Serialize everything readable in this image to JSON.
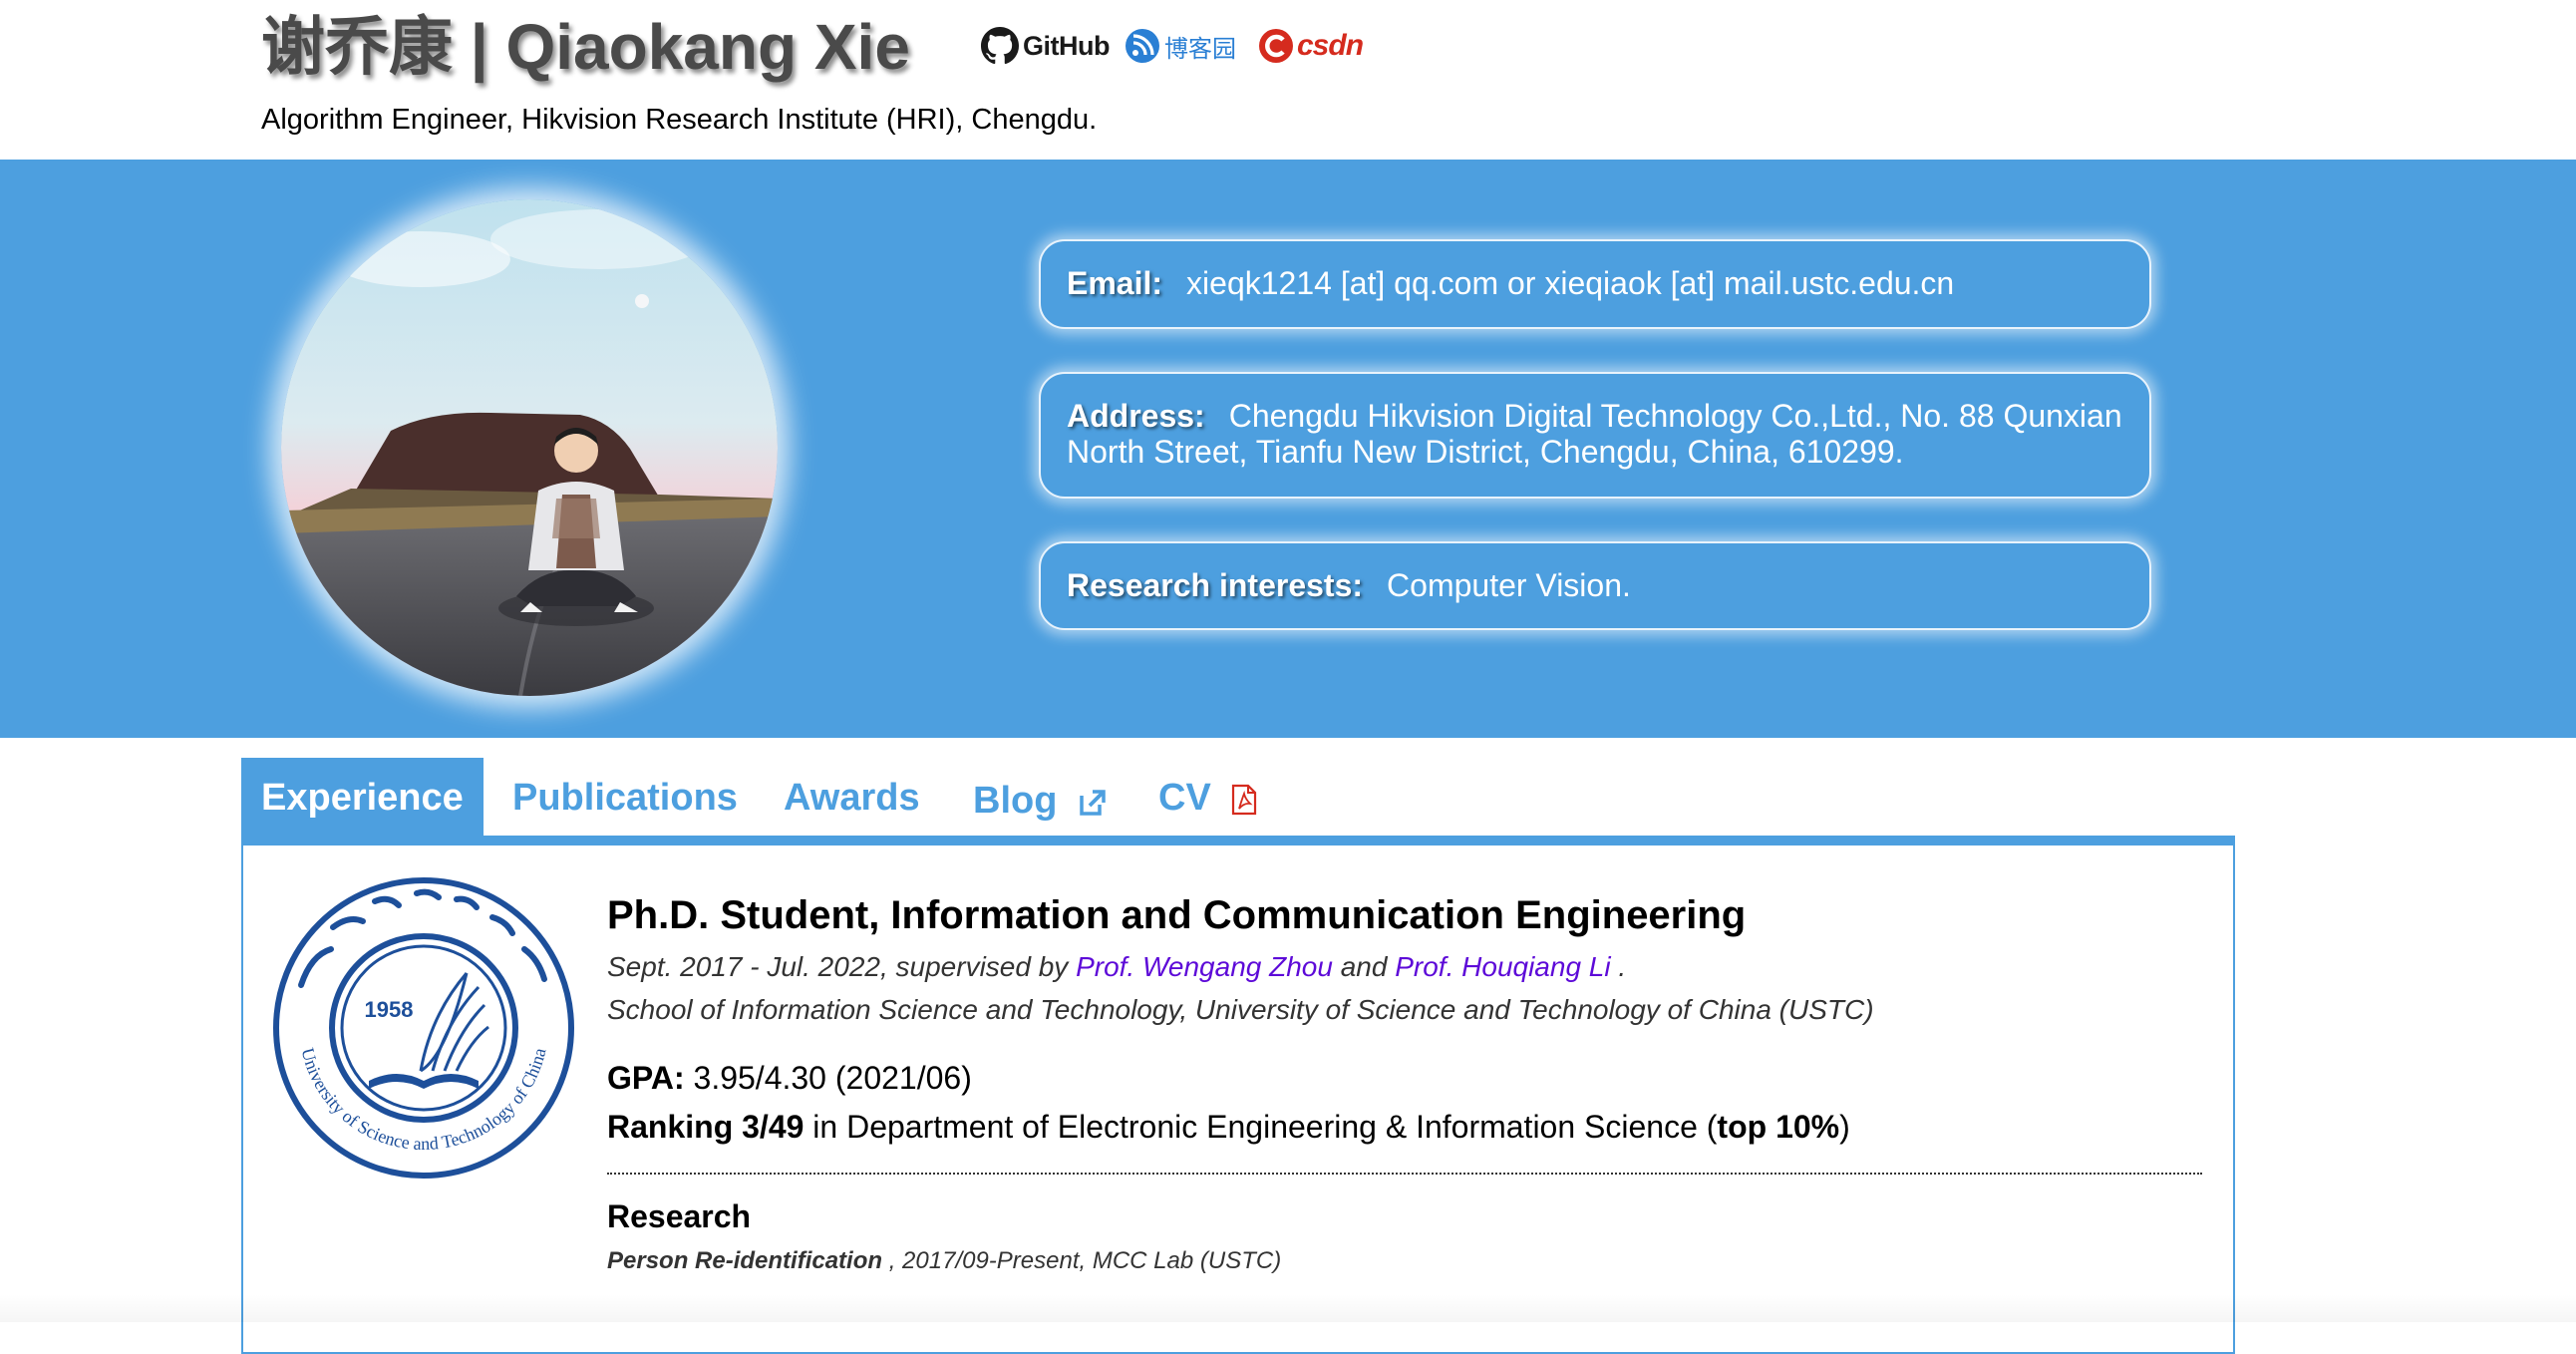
{
  "header": {
    "name": "谢乔康 | Qiaokang Xie",
    "subtitle": "Algorithm Engineer, Hikvision Research Institute (HRI), Chengdu."
  },
  "social": {
    "github_label": "GitHub",
    "cnblogs_label": "博客园",
    "csdn_label": "csdn"
  },
  "contact": {
    "email_label": "Email:",
    "email_value": "xieqk1214 [at] qq.com  or  xieqiaok [at] mail.ustc.edu.cn",
    "address_label": "Address:",
    "address_value": "Chengdu Hikvision Digital Technology Co.,Ltd., No. 88 Qunxian North Street, Tianfu New District, Chengdu, China, 610299.",
    "research_label": "Research interests:",
    "research_value": "Computer Vision."
  },
  "tabs": [
    {
      "label": "Experience",
      "active": true
    },
    {
      "label": "Publications"
    },
    {
      "label": "Awards"
    },
    {
      "label": "Blog",
      "icon": "external-link-icon"
    },
    {
      "label": "CV",
      "icon": "pdf-icon"
    }
  ],
  "experience": {
    "logo": {
      "year": "1958",
      "ring_text": "University of Science and Technology of China",
      "icon": "ustc-logo"
    },
    "degree": "Ph.D. Student, Information and Communication Engineering",
    "period_prefix": "Sept. 2017 - Jul. 2022, supervised by ",
    "advisor1": "Prof. Wengang Zhou",
    "and_text": " and ",
    "advisor2": "Prof. Houqiang Li",
    "period_suffix": " .",
    "school": "School of Information Science and Technology, University of Science and Technology of China (USTC)",
    "gpa_label": "GPA:",
    "gpa_value": " 3.95/4.30 (2021/06)",
    "ranking_label": "Ranking 3/49",
    "ranking_mid": " in Department of Electronic Engineering & Information Science (",
    "ranking_top": "top 10%",
    "ranking_end": ")",
    "research_title": "Research",
    "research_item_name": "Person Re-identification",
    "research_item_detail": " , 2017/09-Present, MCC Lab (USTC)"
  },
  "colors": {
    "accent": "#4d9fdf",
    "link": "#5d0ad8",
    "csdn": "#d52b1e",
    "name": "#4a4a4a"
  }
}
